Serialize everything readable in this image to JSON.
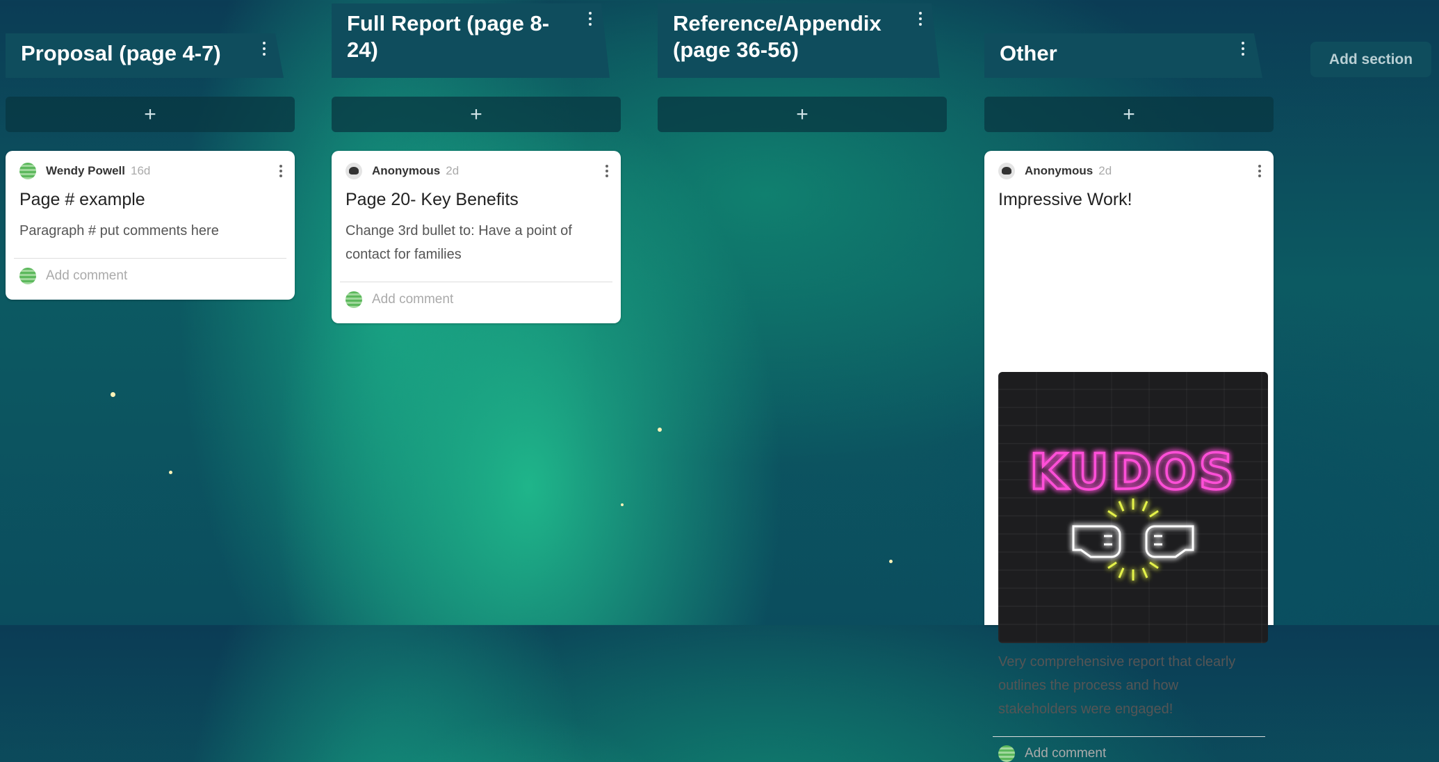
{
  "sections": [
    {
      "title": "Proposal (page 4-7)",
      "cards": [
        {
          "author": "Wendy Powell",
          "time": "16d",
          "title": "Page # example",
          "body": "Paragraph # put comments here",
          "comment_placeholder": "Add comment"
        }
      ]
    },
    {
      "title": "Full Report (page 8-24)",
      "cards": [
        {
          "author": "Anonymous",
          "time": "2d",
          "title": "Page 20- Key Benefits",
          "body": "Change 3rd bullet to: Have a point of contact for families",
          "comment_placeholder": "Add comment"
        }
      ]
    },
    {
      "title": "Reference/Appendix (page 36-56)",
      "cards": []
    },
    {
      "title": "Other",
      "cards": [
        {
          "author": "Anonymous",
          "time": "2d",
          "title": "Impressive Work!",
          "image_text": "KUDOS",
          "body": "Very comprehensive report that clearly outlines the process and how stakeholders were engaged!",
          "comment_placeholder": "Add comment"
        }
      ]
    }
  ],
  "add_post_icon": "plus-icon",
  "add_section_label": "Add section",
  "colors": {
    "section_header": "#0f4d5d",
    "neon_pink": "#ff4fd8",
    "neon_yellow": "#e4f24a"
  }
}
